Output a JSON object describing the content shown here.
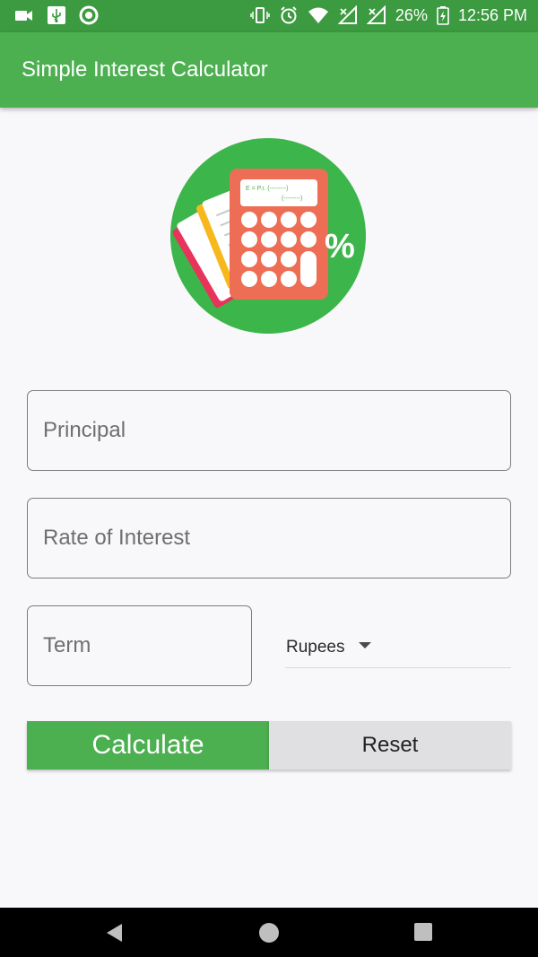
{
  "status_bar": {
    "left_icons": [
      "video-camera-icon",
      "usb-icon",
      "circle-notification-icon"
    ],
    "right_icons": [
      "vibrate-icon",
      "alarm-icon",
      "wifi-icon",
      "signal-x-icon",
      "signal-x-icon",
      "battery-charging-icon"
    ],
    "battery": "26%",
    "time": "12:56 PM"
  },
  "app_bar": {
    "title": "Simple Interest Calculator"
  },
  "logo": {
    "formula_line1": "E = P.r.  (--------)",
    "formula_line2": "(--------)",
    "percent": "%"
  },
  "form": {
    "principal": {
      "placeholder": "Principal"
    },
    "rate": {
      "placeholder": "Rate of Interest"
    },
    "term": {
      "placeholder": "Term"
    },
    "currency": {
      "selected": "Rupees"
    }
  },
  "buttons": {
    "calculate": "Calculate",
    "reset": "Reset"
  },
  "colors": {
    "primary": "#4caf50",
    "status_bar": "#3c9a40",
    "logo_circle": "#3cb54a",
    "calculator": "#ee6e55"
  },
  "nav_bar": {
    "icons": [
      "back-icon",
      "home-icon",
      "recents-icon"
    ]
  }
}
